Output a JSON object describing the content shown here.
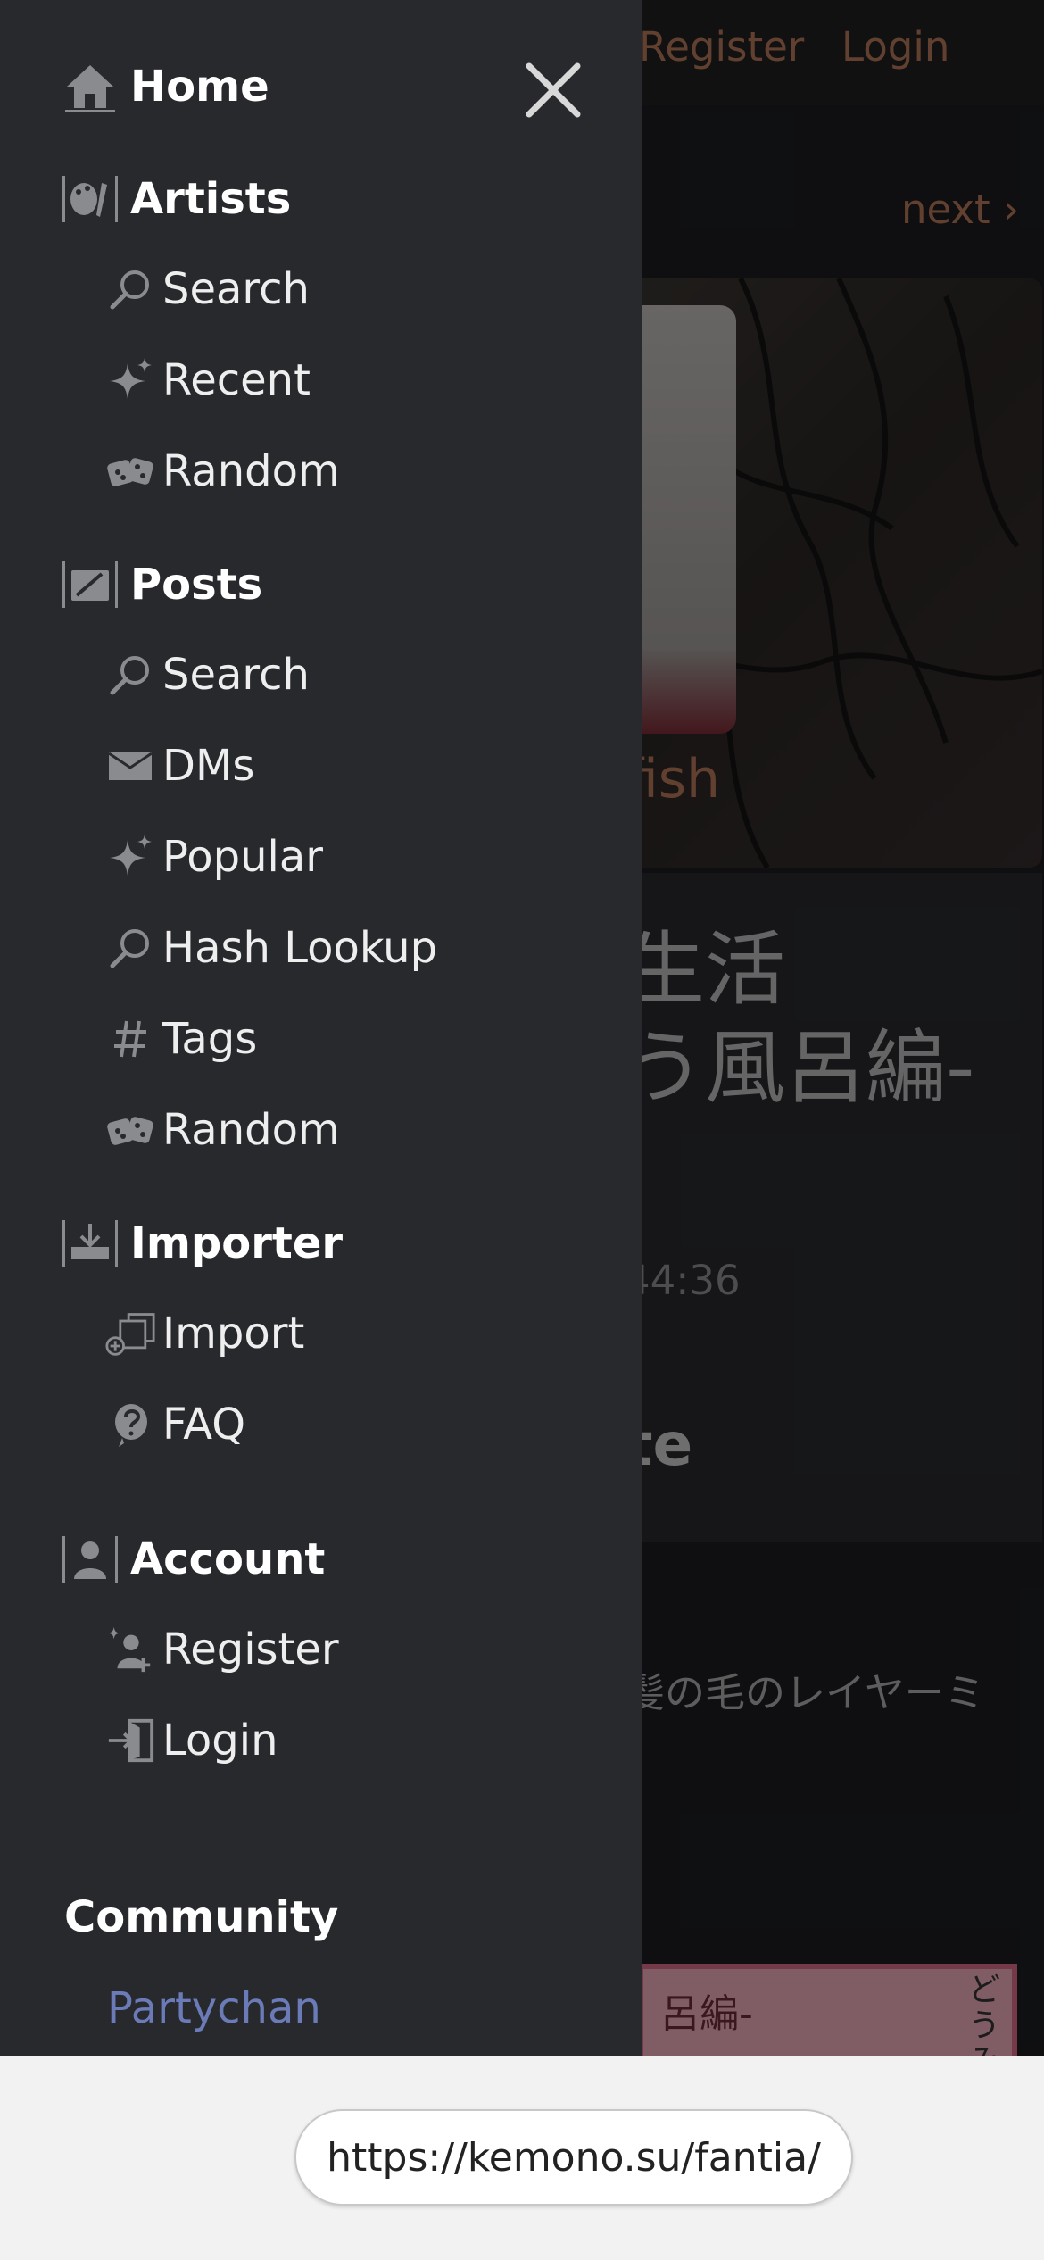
{
  "background": {
    "top_links": [
      "Register",
      "Login"
    ],
    "next_label": "next ›",
    "artist_fragment": "fish",
    "title_lines": [
      "生活",
      "う風呂編-"
    ],
    "time_fragment": "44:36",
    "bold_fragment": "te",
    "desc_fragment": "髪の毛のレイヤーミ",
    "thumb_text": "呂編-",
    "thumb_vertical": "どうみこと"
  },
  "drawer": {
    "close_icon": "close-icon",
    "home": "Home",
    "artists": {
      "label": "Artists",
      "items": [
        "Search",
        "Recent",
        "Random"
      ]
    },
    "posts": {
      "label": "Posts",
      "items": [
        "Search",
        "DMs",
        "Popular",
        "Hash Lookup",
        "Tags",
        "Random"
      ]
    },
    "importer": {
      "label": "Importer",
      "items": [
        "Import",
        "FAQ"
      ]
    },
    "account": {
      "label": "Account",
      "items": [
        "Register",
        "Login"
      ]
    },
    "community": {
      "label": "Community",
      "items": [
        "Partychan"
      ]
    }
  },
  "browser": {
    "url": "https://kemono.su/fantia/"
  },
  "colors": {
    "drawer_bg": "#28292d",
    "accent": "#b27658",
    "link": "#6b7bb8",
    "icon": "#8a8b8e"
  }
}
